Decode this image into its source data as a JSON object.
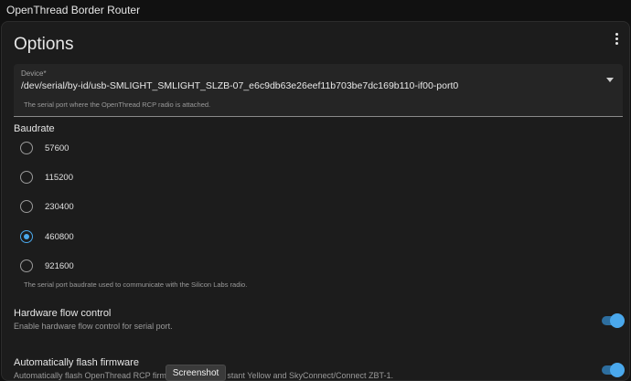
{
  "app": {
    "title": "OpenThread Border Router"
  },
  "card": {
    "title": "Options"
  },
  "device": {
    "label": "Device*",
    "value": "/dev/serial/by-id/usb-SMLIGHT_SMLIGHT_SLZB-07_e6c9db63e26eef11b703be7dc169b110-if00-port0",
    "helper": "The serial port where the OpenThread RCP radio is attached."
  },
  "baudrate": {
    "label": "Baudrate",
    "options": [
      "57600",
      "115200",
      "230400",
      "460800",
      "921600"
    ],
    "selected": "460800",
    "helper": "The serial port baudrate used to communicate with the Silicon Labs radio."
  },
  "flow_control": {
    "title": "Hardware flow control",
    "description": "Enable hardware flow control for serial port.",
    "enabled": true
  },
  "auto_flash": {
    "title": "Automatically flash firmware",
    "description": "Automatically flash OpenThread RCP firmw",
    "description_tail": "stant Yellow and SkyConnect/Connect ZBT-1.",
    "enabled": true
  },
  "tooltip": {
    "text": "Screenshot"
  },
  "colors": {
    "accent": "#4aa8ec",
    "background": "#111111",
    "card": "#1c1c1c"
  },
  "icons": {
    "menu": "more-vert-icon",
    "dropdown": "caret-down-icon"
  }
}
